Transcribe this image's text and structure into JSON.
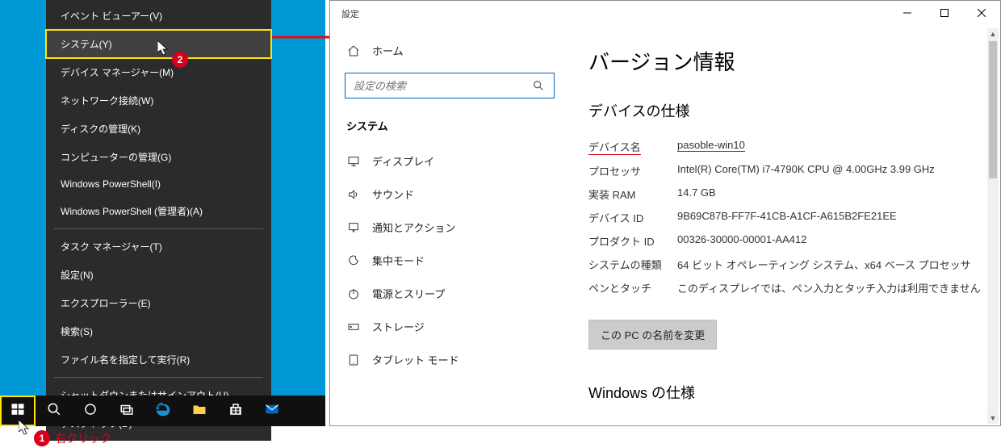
{
  "context_menu": {
    "items": [
      "イベント ビューアー(V)",
      "システム(Y)",
      "デバイス マネージャー(M)",
      "ネットワーク接続(W)",
      "ディスクの管理(K)",
      "コンピューターの管理(G)",
      "Windows PowerShell(I)",
      "Windows PowerShell (管理者)(A)"
    ],
    "items2": [
      "タスク マネージャー(T)",
      "設定(N)",
      "エクスプローラー(E)",
      "検索(S)",
      "ファイル名を指定して実行(R)"
    ],
    "items3": [
      "シャットダウンまたはサインアウト(U)",
      "デスクトップ(D)"
    ],
    "highlighted_index": 1
  },
  "annotations": {
    "badge1_num": "1",
    "badge1_text": "右クリック",
    "badge2_num": "2"
  },
  "settings": {
    "window_title": "設定",
    "home_label": "ホーム",
    "search_placeholder": "設定の検索",
    "section_heading": "システム",
    "sidebar": [
      {
        "icon": "display",
        "label": "ディスプレイ"
      },
      {
        "icon": "sound",
        "label": "サウンド"
      },
      {
        "icon": "notify",
        "label": "通知とアクション"
      },
      {
        "icon": "focus",
        "label": "集中モード"
      },
      {
        "icon": "power",
        "label": "電源とスリープ"
      },
      {
        "icon": "storage",
        "label": "ストレージ"
      },
      {
        "icon": "tablet",
        "label": "タブレット モード"
      }
    ],
    "content": {
      "h1": "バージョン情報",
      "spec_heading": "デバイスの仕様",
      "specs": [
        {
          "label": "デバイス名",
          "value": "pasoble-win10"
        },
        {
          "label": "プロセッサ",
          "value": "Intel(R) Core(TM) i7-4790K CPU @ 4.00GHz   3.99 GHz"
        },
        {
          "label": "実装 RAM",
          "value": "14.7 GB"
        },
        {
          "label": "デバイス ID",
          "value": "9B69C87B-FF7F-41CB-A1CF-A615B2FE21EE"
        },
        {
          "label": "プロダクト ID",
          "value": "00326-30000-00001-AA412"
        },
        {
          "label": "システムの種類",
          "value": "64 ビット オペレーティング システム、x64 ベース プロセッサ"
        },
        {
          "label": "ペンとタッチ",
          "value": "このディスプレイでは、ペン入力とタッチ入力は利用できません"
        }
      ],
      "rename_button": "この PC の名前を変更",
      "windows_heading": "Windows の仕様"
    }
  }
}
